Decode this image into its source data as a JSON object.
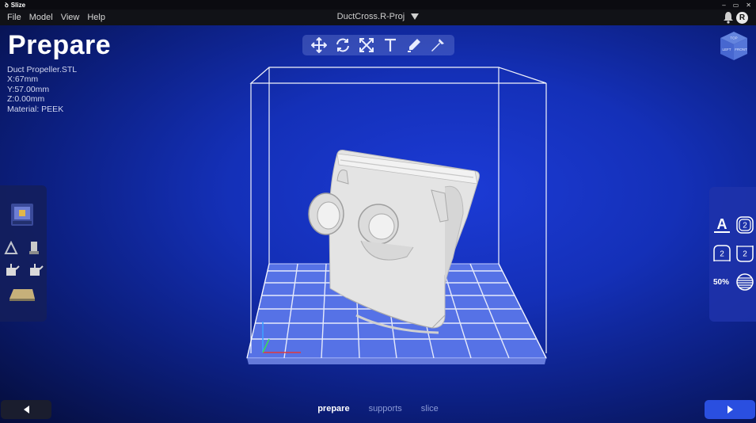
{
  "app": {
    "name": "Slize",
    "project": "DuctCross.R-Proj",
    "avatar_initial": "R"
  },
  "menu": [
    "File",
    "Model",
    "View",
    "Help"
  ],
  "window_controls": [
    "–",
    "▭",
    "✕"
  ],
  "page": {
    "title": "Prepare"
  },
  "model": {
    "filename": "Duct Propeller.STL",
    "x": "X:67mm",
    "y": "Y:57.00mm",
    "z": "Z:0.00mm",
    "material": "Material: PEEK"
  },
  "toolbar": [
    "move-icon",
    "rotate-icon",
    "scale-icon",
    "text-icon",
    "paint-icon",
    "repair-icon"
  ],
  "viewcube": {
    "top": "TOP",
    "left": "LEFT",
    "front": "FRONT"
  },
  "right_panel": {
    "font_letter": "A",
    "badge_1": "2",
    "badge_2": "2",
    "badge_3": "2",
    "infill": "50%"
  },
  "steps": {
    "prepare": "prepare",
    "supports": "supports",
    "slice": "slice",
    "active": "prepare"
  },
  "colors": {
    "accent": "#2a4fe0",
    "background": "#1430b8",
    "model": "#e6e6e6"
  }
}
